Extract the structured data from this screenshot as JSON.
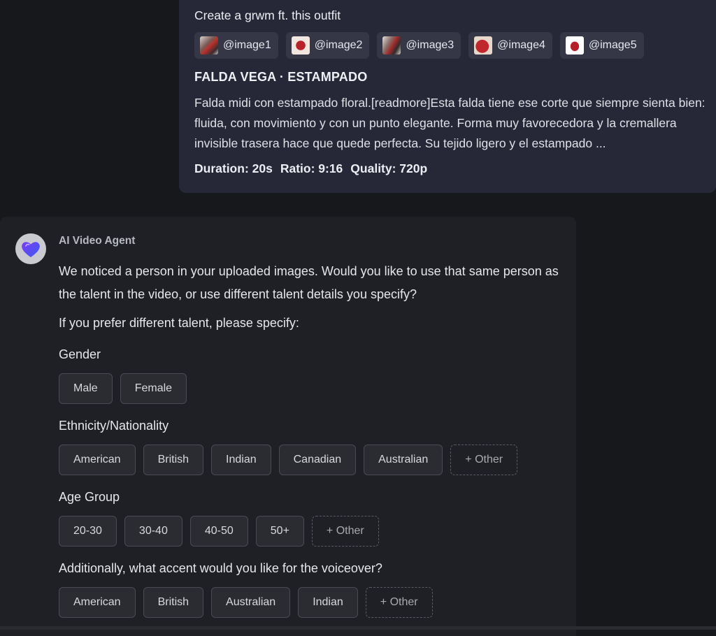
{
  "prompt": {
    "text": "Create a grwm ft. this outfit",
    "images": [
      {
        "label": "@image1"
      },
      {
        "label": "@image2"
      },
      {
        "label": "@image3"
      },
      {
        "label": "@image4"
      },
      {
        "label": "@image5"
      }
    ],
    "product_title": "FALDA VEGA · ESTAMPADO",
    "description": "Falda midi con estampado floral.[readmore]Esta falda tiene ese corte que siempre sienta bien: fluida, con movimiento y con un punto elegante. Forma muy favorecedora y la cremallera invisible trasera hace que quede perfecta. Su tejido ligero y el estampado ...",
    "duration": "Duration: 20s",
    "ratio": "Ratio: 9:16",
    "quality": "Quality: 720p"
  },
  "agent": {
    "name": "AI Video Agent",
    "avatar_icon": "heart-icon",
    "message": "We noticed a person in your uploaded images. Would you like to use that same person as the talent in the video, or use different talent details you specify?",
    "prompt_line": "If you prefer different talent, please specify:",
    "gender": {
      "label": "Gender",
      "options": [
        "Male",
        "Female"
      ]
    },
    "ethnicity": {
      "label": "Ethnicity/Nationality",
      "options": [
        "American",
        "British",
        "Indian",
        "Canadian",
        "Australian"
      ],
      "other": "+ Other"
    },
    "age": {
      "label": "Age Group",
      "options": [
        "20-30",
        "30-40",
        "40-50",
        "50+"
      ],
      "other": "+ Other"
    },
    "accent": {
      "label": "Additionally, what accent would you like for the voiceover?",
      "options": [
        "American",
        "British",
        "Australian",
        "Indian"
      ],
      "other": "+ Other"
    }
  },
  "colors": {
    "background": "#17181b",
    "user_bubble": "#262838",
    "agent_card": "#1f2025",
    "avatar_heart": "#5b4df0"
  }
}
